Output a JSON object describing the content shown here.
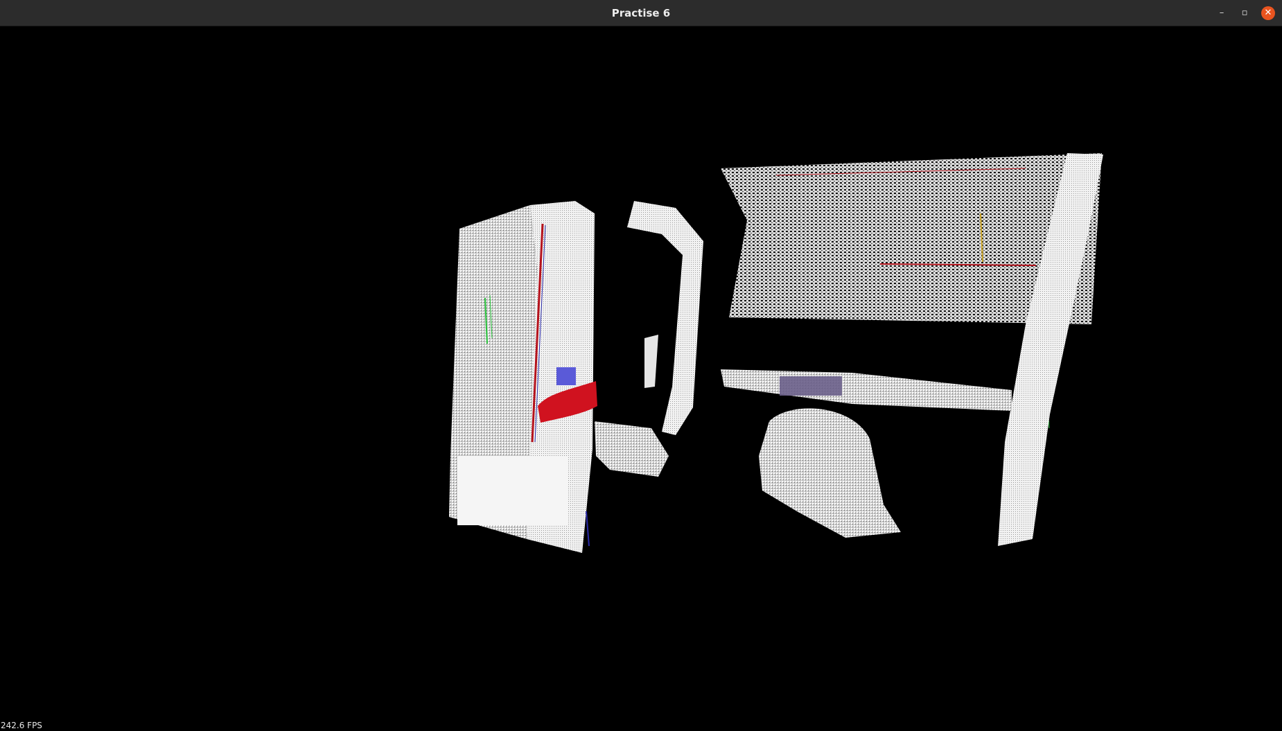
{
  "window": {
    "title": "Practise 6",
    "controls": {
      "minimize": "–",
      "maximize": "▫",
      "close": "✕"
    }
  },
  "viewport": {
    "fps_label": "242.6 FPS",
    "background": "#000000",
    "point_color": "#ffffff",
    "highlight_colors": {
      "red_cluster": "#d0121f",
      "blue_cluster": "#5a5ad8",
      "purple_cluster": "#6a5f8a",
      "green_points": "#27c23a"
    }
  }
}
